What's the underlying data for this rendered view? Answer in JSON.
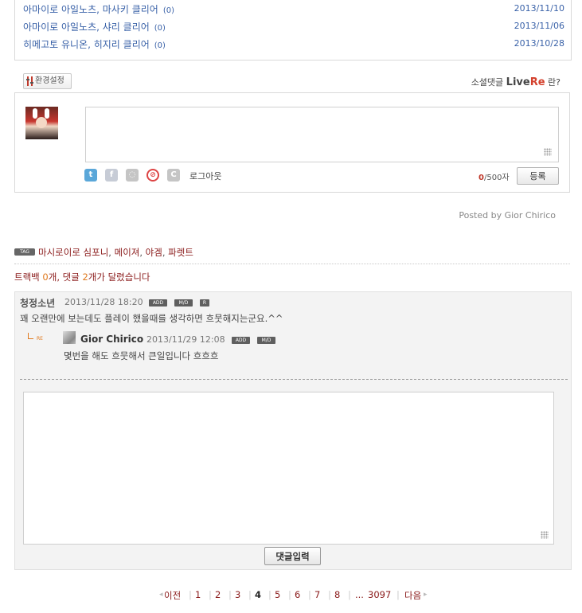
{
  "related_posts": [
    {
      "title": "아마이로 아일노츠, 마사키 클리어",
      "count": "(0)",
      "date": "2013/11/10"
    },
    {
      "title": "아마이로 아일노츠, 샤리 클리어",
      "count": "(0)",
      "date": "2013/11/06"
    },
    {
      "title": "히메고토 유니온, 히지리 클리어",
      "count": "(0)",
      "date": "2013/10/28"
    }
  ],
  "livere": {
    "settings_label": "환경설정",
    "brand_prefix": "소셜댓글",
    "brand_live": "Live",
    "brand_re": "Re",
    "brand_suffix": "란?",
    "logout_label": "로그아웃",
    "char_count_current": "0",
    "char_count_max": "/500자",
    "submit_label": "등록",
    "sns_icons": [
      "twitter-icon",
      "facebook-icon",
      "me2day-icon",
      "weibo-icon",
      "cyworld-icon"
    ]
  },
  "posted_by": "Posted by Gior Chirico",
  "tags": {
    "badge": "TAG",
    "items": [
      "마시로이로 심포니",
      "메이져",
      "야겜",
      "파렛트"
    ],
    "separator": ","
  },
  "trackback": {
    "prefix": "트랙백 ",
    "trackback_count": "0",
    "middle": "개, 댓글 ",
    "comment_count": "2",
    "suffix": "개가 달렸습니다"
  },
  "comments": [
    {
      "author": "청정소년",
      "date": "2013/11/28 18:20",
      "buttons": [
        "ADD",
        "M/D",
        "R"
      ],
      "body": "꽤 오랜만에 보는데도 플레이 했을때를 생각하면 흐뭇해지는군요.^^",
      "replies": [
        {
          "re_label": "RE",
          "author": "Gior Chirico",
          "date": "2013/11/29 12:08",
          "buttons": [
            "ADD",
            "M/D"
          ],
          "body": "몇번을 해도 흐뭇해서 큰일입니다 흐흐흐"
        }
      ]
    }
  ],
  "comment_form": {
    "submit_label": "댓글입력"
  },
  "pagination": {
    "prev_label": "이전",
    "pages": [
      "1",
      "2",
      "3",
      "4",
      "5",
      "6",
      "7",
      "8"
    ],
    "current_page": "4",
    "ellipsis": "...",
    "last_page": "3097",
    "next_label": "다음"
  },
  "colors": {
    "link_blue": "#3a62a8",
    "tag_red": "#8a1a1a",
    "count_orange": "#e07a1f",
    "livere_red": "#d3402c"
  }
}
